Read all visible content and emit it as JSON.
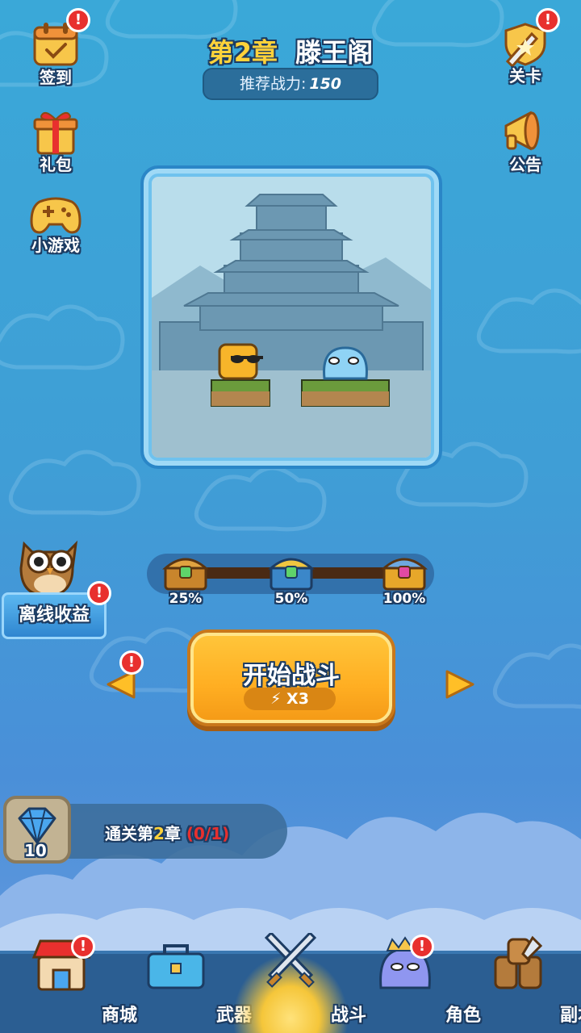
{
  "header": {
    "chapter_prefix": "第",
    "chapter_num": "2",
    "chapter_suffix": "章",
    "chapter_name": "滕王阁",
    "power_label": "推荐战力:",
    "power_value": "150"
  },
  "left_menu": [
    {
      "label": "签到",
      "icon": "calendar-icon",
      "badge": "!"
    },
    {
      "label": "礼包",
      "icon": "gift-icon"
    },
    {
      "label": "小游戏",
      "icon": "gamepad-icon"
    }
  ],
  "right_menu": [
    {
      "label": "关卡",
      "icon": "sword-shield-icon",
      "badge": "!"
    },
    {
      "label": "公告",
      "icon": "megaphone-icon"
    }
  ],
  "progress": {
    "chests": [
      {
        "label": "25%"
      },
      {
        "label": "50%"
      },
      {
        "label": "100%"
      }
    ]
  },
  "offline": {
    "label": "离线收益",
    "badge": "!"
  },
  "start": {
    "label": "开始战斗",
    "cost": "X3",
    "left_badge": "!"
  },
  "quest": {
    "prefix": "通关第",
    "num": "2",
    "suffix": "章",
    "count": "(0/1)",
    "reward": "10"
  },
  "nav": [
    {
      "label": "商城",
      "icon": "shop-icon",
      "badge": "!"
    },
    {
      "label": "武器",
      "icon": "toolbox-icon"
    },
    {
      "label": "战斗",
      "icon": "crossed-swords-icon",
      "active": true
    },
    {
      "label": "角色",
      "icon": "slime-crown-icon",
      "badge": "!"
    },
    {
      "label": "副本",
      "icon": "wood-axe-icon"
    }
  ],
  "colors": {
    "accent_yellow": "#ffd23a",
    "badge_red": "#e8302e",
    "nav_bg": "#2b5e92",
    "start_orange": "#ffae22"
  }
}
